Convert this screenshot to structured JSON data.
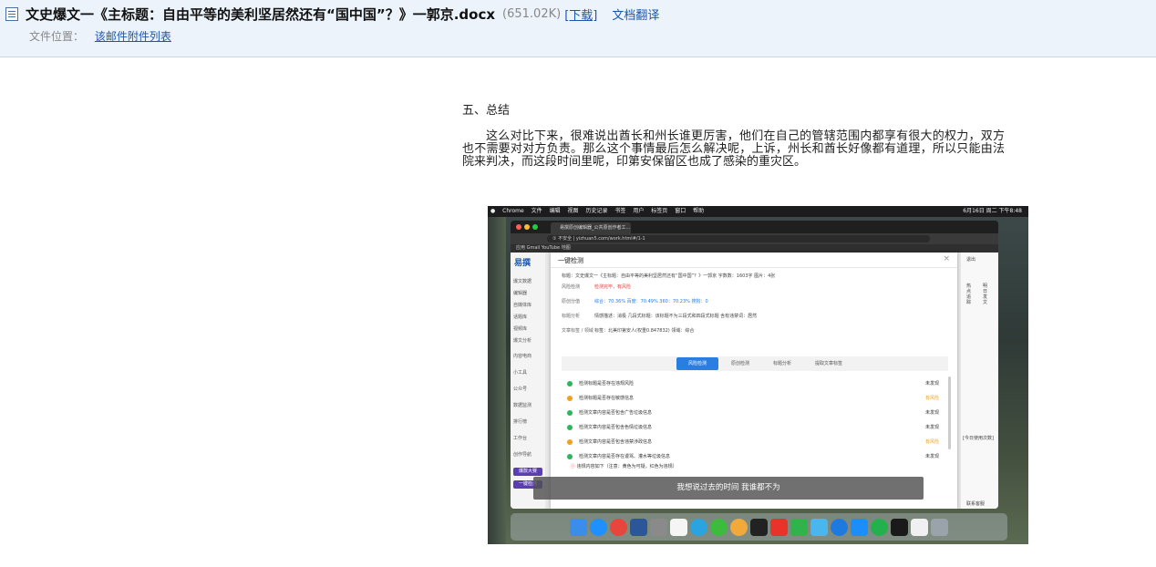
{
  "header": {
    "file_name": "文史爆文一《主标题：自由平等的美利坚居然还有“国中国”？》一郭京.docx",
    "file_size": "(651.02K)",
    "download_label": "[下载]",
    "translate_label": "文档翻译",
    "location_label": "文件位置：",
    "location_link": "该邮件附件列表"
  },
  "document": {
    "heading": "五、总结",
    "paragraph": "这么对比下来，很难说出酋长和州长谁更厉害，他们在自己的管辖范围内都享有很大的权力，双方也不需要对对方负责。那么这个事情最后怎么解决呢，上诉，州长和酋长好像都有道理，所以只能由法院来判决，而这段时间里呢，印第安保留区也成了感染的重灾区。"
  },
  "screenshot": {
    "menubar": [
      "Chrome",
      "文件",
      "编辑",
      "视图",
      "历史记录",
      "书签",
      "用户",
      "标签页",
      "窗口",
      "帮助"
    ],
    "menubar_right": "6月16日 周二 下午8:48",
    "tab_title": "易撰原创编辑器_公共原创作者工...",
    "address": "① 不安全 | yizhuan5.com/work.html#/1-1",
    "bookmarks": "应用   Gmail   YouTube   地图",
    "logo": "易撰",
    "sidebar_items": [
      "爆文数据",
      "编辑器",
      "自媒体库",
      "话题库",
      "视频库",
      "爆文分析",
      "内容电商",
      "小工具",
      "公众号",
      "数据监测",
      "排行榜",
      "工作台",
      "创作导航"
    ],
    "sidebar_buttons": [
      "爆款大赛",
      "一键检测"
    ],
    "modal": {
      "title": "一键检测",
      "close": "×",
      "meta_line": "标题：文史爆文一《主标题：自由平等的美利坚居然还有“国中国”？》一郭京    字数数：1603字    图片：4张",
      "risk_label": "风险检测",
      "risk_value": "检测完毕，有风险",
      "orig_label": "原创分值",
      "orig_value": "综合：70.36%   百度：70.49%   360：70.23%   搜狗：0",
      "title_label": "标题分析",
      "title_value": "情感描述：消极   几段式标题：该标题不为三段式和四段式标题   含有违禁词：居然",
      "field_label": "文章标签 / 领域",
      "field_value": "标签：北美印第安人(权重0.847832)      领域：综合",
      "tabs": [
        "风险检测",
        "原创检测",
        "标题分析",
        "提取文章标签"
      ],
      "checks": [
        {
          "text": "检测标题是否存在违规风险",
          "status": "未发现",
          "ok": true
        },
        {
          "text": "检测标题是否存在敏感信息",
          "status": "有风险",
          "ok": false
        },
        {
          "text": "检测文章内容是否包含广告垃圾信息",
          "status": "未发现",
          "ok": true
        },
        {
          "text": "检测文章内容是否包含色情垃圾信息",
          "status": "未发现",
          "ok": true
        },
        {
          "text": "检测文章内容是否包含违禁涉政信息",
          "status": "有风险",
          "ok": false
        },
        {
          "text": "检测文章内容是否存在谩骂、灌水等垃圾信息",
          "status": "未发现",
          "ok": true
        }
      ],
      "warn": "违规内容如下（注意：黄色为可疑，红色为违规）"
    },
    "subtitle": "我想说过去的时间 我谁都不为",
    "right_panel": [
      "退出",
      "热点追踪",
      "明日发文",
      "[今日使用次数]",
      "联系客服"
    ],
    "colors": {
      "blue": "#2a7de1",
      "red": "#e03b3b",
      "ok_green": "#2db55d",
      "warn_orange": "#f0a020"
    }
  }
}
